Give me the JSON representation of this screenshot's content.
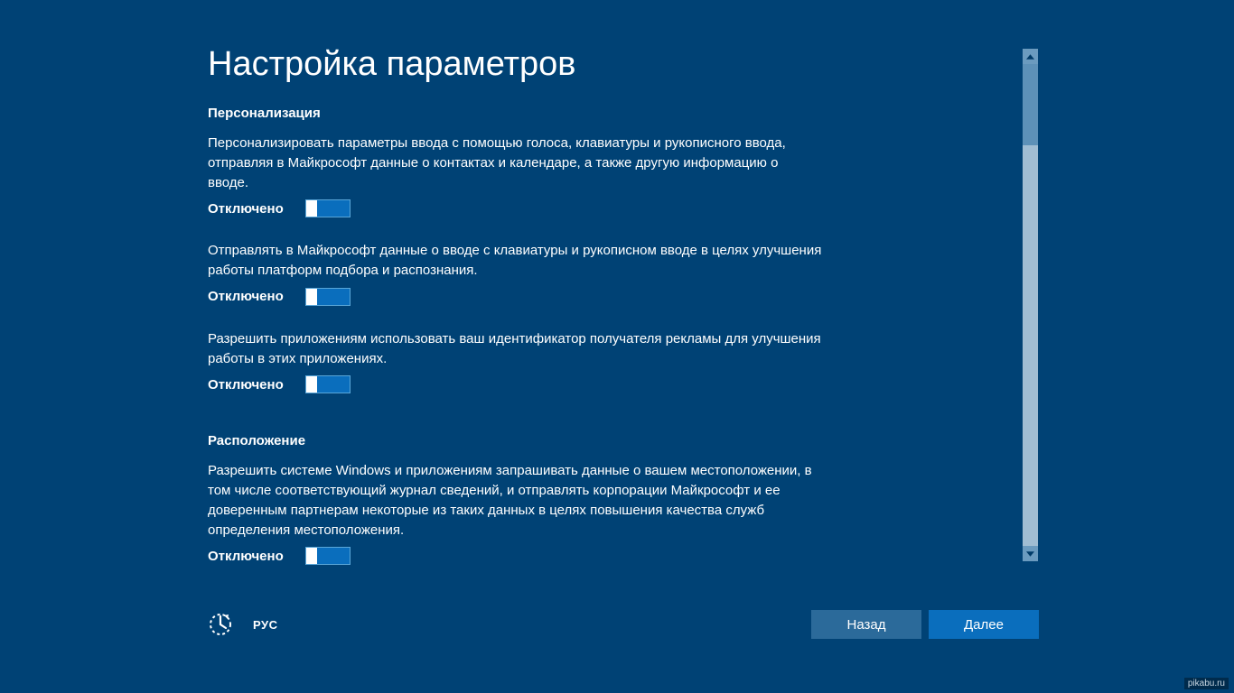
{
  "page_title": "Настройка параметров",
  "sections": [
    {
      "heading": "Персонализация",
      "settings": [
        {
          "desc": "Персонализировать параметры ввода с помощью голоса, клавиатуры и рукописного ввода, отправляя в Майкрософт данные о контактах и календаре, а также другую информацию о вводе.",
          "state_label": "Отключено",
          "state": "off"
        },
        {
          "desc": "Отправлять в Майкрософт данные о вводе с клавиатуры и рукописном вводе в целях улучшения работы платформ подбора и распознания.",
          "state_label": "Отключено",
          "state": "off"
        },
        {
          "desc": "Разрешить приложениям использовать ваш идентификатор получателя рекламы для улучшения работы в этих приложениях.",
          "state_label": "Отключено",
          "state": "off"
        }
      ]
    },
    {
      "heading": "Расположение",
      "settings": [
        {
          "desc": "Разрешить системе Windows и приложениям запрашивать данные о вашем местоположении, в том числе соответствующий журнал сведений, и отправлять корпорации Майкрософт и ее доверенным партнерам некоторые из таких данных в целях повышения качества служб определения местоположения.",
          "state_label": "Отключено",
          "state": "off"
        }
      ]
    }
  ],
  "footer": {
    "lang": "РУС",
    "back_label": "Назад",
    "next_label": "Далее"
  },
  "watermark": "pikabu.ru"
}
